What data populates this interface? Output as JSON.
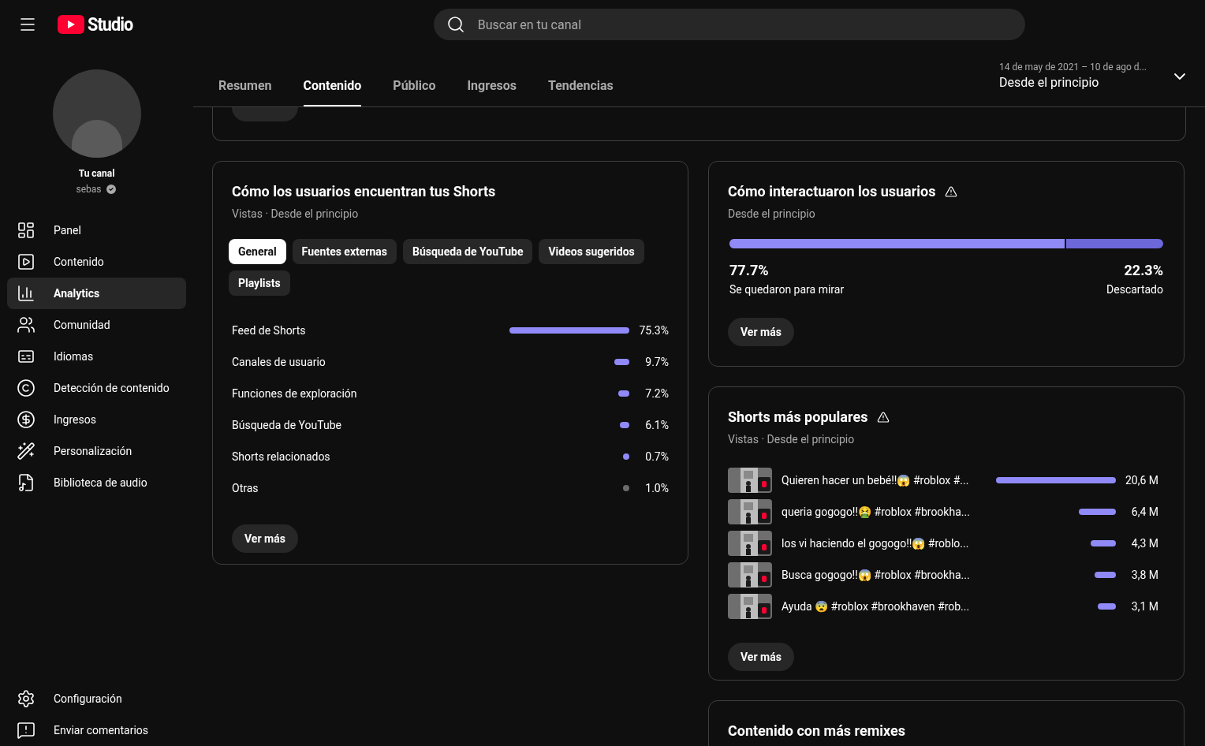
{
  "header": {
    "logo_text": "Studio",
    "search": {
      "placeholder": "Buscar en tu canal"
    }
  },
  "channel": {
    "label": "Tu canal",
    "name": "sebas"
  },
  "sidebar": {
    "items": [
      {
        "label": "Panel",
        "selected": false
      },
      {
        "label": "Contenido",
        "selected": false
      },
      {
        "label": "Analytics",
        "selected": true
      },
      {
        "label": "Comunidad",
        "selected": false
      },
      {
        "label": "Idiomas",
        "selected": false
      },
      {
        "label": "Detección de contenido",
        "selected": false
      },
      {
        "label": "Ingresos",
        "selected": false
      },
      {
        "label": "Personalización",
        "selected": false
      },
      {
        "label": "Biblioteca de audio",
        "selected": false
      }
    ],
    "bottom_items": [
      {
        "label": "Configuración"
      },
      {
        "label": "Enviar comentarios"
      }
    ]
  },
  "tabs": [
    {
      "label": "Resumen",
      "selected": false
    },
    {
      "label": "Contenido",
      "selected": true
    },
    {
      "label": "Público",
      "selected": false
    },
    {
      "label": "Ingresos",
      "selected": false
    },
    {
      "label": "Tendencias",
      "selected": false
    }
  ],
  "date_range": {
    "range": "14 de may de 2021 – 10 de ago d...",
    "label": "Desde el principio"
  },
  "sources_card": {
    "title": "Cómo los usuarios encuentran tus Shorts",
    "subtitle": "Vistas · Desde el principio",
    "chips": [
      {
        "label": "General",
        "selected": true
      },
      {
        "label": "Fuentes externas",
        "selected": false
      },
      {
        "label": "Búsqueda de YouTube",
        "selected": false
      },
      {
        "label": "Videos sugeridos",
        "selected": false
      },
      {
        "label": "Playlists",
        "selected": false
      }
    ],
    "rows": [
      {
        "label": "Feed de Shorts",
        "value": "75.3%",
        "color": "#8f8af7"
      },
      {
        "label": "Canales de usuario",
        "value": "9.7%",
        "color": "#8f8af7"
      },
      {
        "label": "Funciones de exploración",
        "value": "7.2%",
        "color": "#8f8af7"
      },
      {
        "label": "Búsqueda de YouTube",
        "value": "6.1%",
        "color": "#8f8af7"
      },
      {
        "label": "Shorts relacionados",
        "value": "0.7%",
        "color": "#8f8af7"
      },
      {
        "label": "Otras",
        "value": "1.0%",
        "color": "#6b6b6b"
      }
    ],
    "button": "Ver más"
  },
  "interaction_card": {
    "title": "Cómo interactuaron los usuarios",
    "subtitle": "Desde el principio",
    "level": 0.777,
    "stayed_value": "77.7%",
    "stayed_label": "Se quedaron para mirar",
    "swiped_value": "22.3%",
    "swiped_label": "Descartado",
    "button": "Ver más"
  },
  "popular_card": {
    "title": "Shorts más populares",
    "subtitle": "Vistas · Desde el principio",
    "rows": [
      {
        "title": "Quieren hacer un bebé!!😱 #roblox #...",
        "value": "20,6 M"
      },
      {
        "title": "queria gogogo!!🤮 #roblox #brookha...",
        "value": "6,4 M"
      },
      {
        "title": "los vi haciendo el gogogo!!😱 #roblo...",
        "value": "4,3 M"
      },
      {
        "title": "Busca gogogo!!😱 #roblox #brookha...",
        "value": "3,8 M"
      },
      {
        "title": "Ayuda 😨 #roblox #brookhaven #rob...",
        "value": "3,1 M"
      }
    ],
    "button": "Ver más"
  },
  "remix_card": {
    "title": "Contenido con más remixes"
  }
}
